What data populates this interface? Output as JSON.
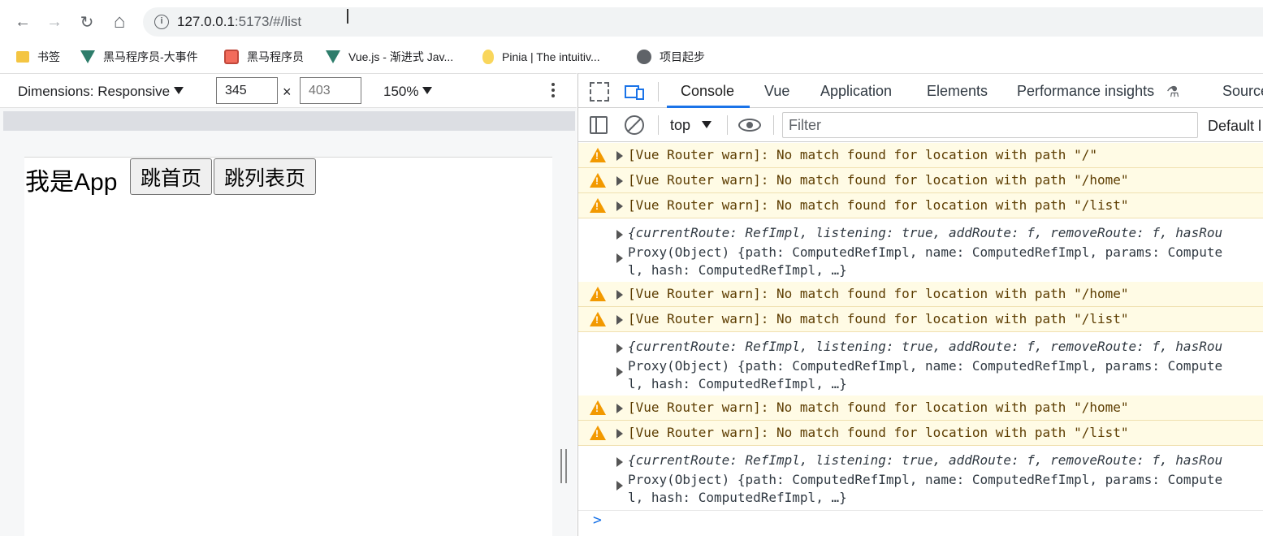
{
  "browser": {
    "url_host": "127.0.0.1",
    "url_rest": ":5173/#/list",
    "back_label": "←",
    "forward_label": "→",
    "reload_label": "↻",
    "home_label": "⌂",
    "info_label": "i"
  },
  "bookmarks": [
    {
      "label": "书签",
      "icon": "folder-icon"
    },
    {
      "label": "黑马程序员-大事件",
      "icon": "vue-icon"
    },
    {
      "label": "黑马程序员",
      "icon": "calendar-icon"
    },
    {
      "label": "Vue.js - 渐进式 Jav...",
      "icon": "vue-icon"
    },
    {
      "label": "Pinia | The intuitiv...",
      "icon": "pinia-icon"
    },
    {
      "label": "项目起步",
      "icon": "globe-icon"
    }
  ],
  "device_toolbar": {
    "dimensions_label": "Dimensions: Responsive",
    "width": "345",
    "height": "403",
    "times": "×",
    "zoom": "150%"
  },
  "page": {
    "app_text": "我是App",
    "btn_home": "跳首页",
    "btn_list": "跳列表页"
  },
  "devtools": {
    "tabs": [
      "Console",
      "Vue",
      "Application",
      "Elements",
      "Performance insights",
      "Source"
    ],
    "active_tab": "Console",
    "context": "top",
    "filter_placeholder": "Filter",
    "levels": "Default l"
  },
  "console": {
    "warn1": "[Vue Router warn]: No match found for location with path \"/\"",
    "warn2": "[Vue Router warn]: No match found for location with path \"/home\"",
    "warn3": "[Vue Router warn]: No match found for location with path \"/list\"",
    "log_line1": "{currentRoute: RefImpl, listening: true, addRoute: f, removeRoute: f, hasRou",
    "log_line2": "Proxy(Object) {path: ComputedRefImpl, name: ComputedRefImpl, params: Compute",
    "log_line3": "l, hash: ComputedRefImpl, …}",
    "warn_symbol": "!",
    "prompt": ">"
  }
}
